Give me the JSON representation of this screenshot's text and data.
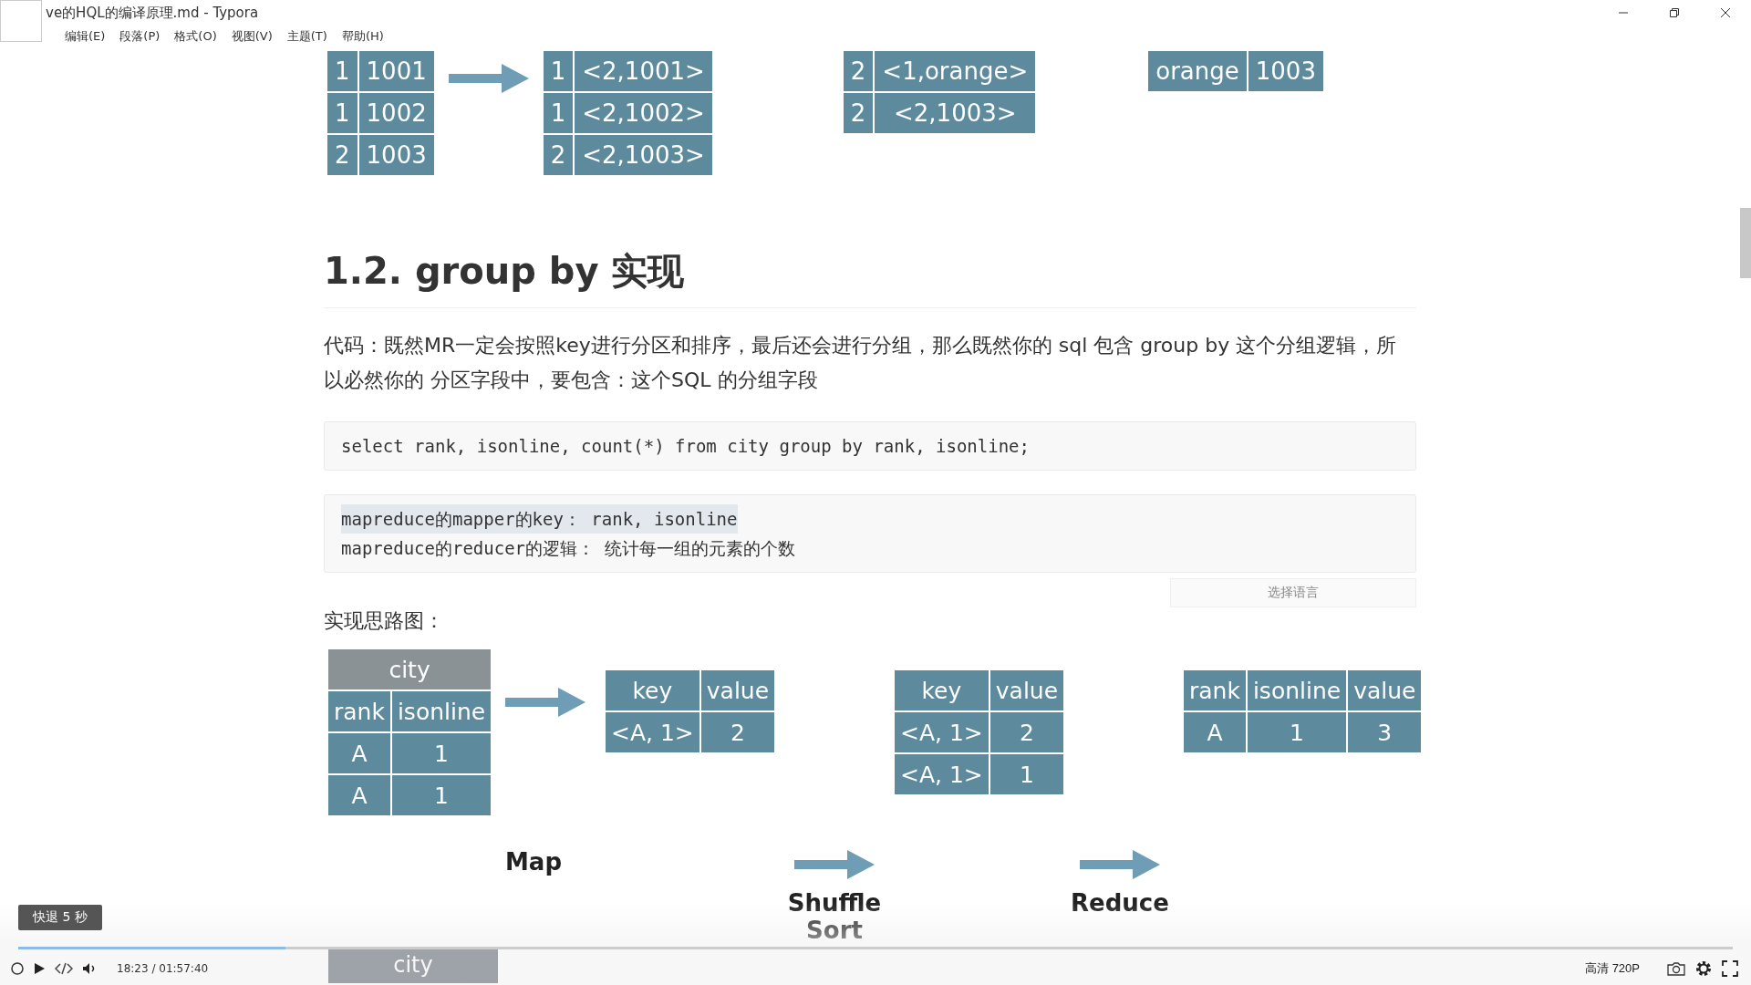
{
  "window": {
    "title": "ve的HQL的编译原理.md - Typora"
  },
  "menu": [
    {
      "label": "编辑(E)"
    },
    {
      "label": "段落(P)"
    },
    {
      "label": "格式(O)"
    },
    {
      "label": "视图(V)"
    },
    {
      "label": "主题(T)"
    },
    {
      "label": "帮助(H)"
    }
  ],
  "document": {
    "top_diagram": {
      "tables": [
        {
          "rows": [
            [
              "1",
              "1001"
            ],
            [
              "1",
              "1002"
            ],
            [
              "2",
              "1003"
            ]
          ]
        },
        {
          "rows": [
            [
              "1",
              "<2,1001>"
            ],
            [
              "1",
              "<2,1002>"
            ],
            [
              "2",
              "<2,1003>"
            ]
          ]
        },
        {
          "rows": [
            [
              "2",
              "<1,orange>"
            ],
            [
              "2",
              "<2,1003>"
            ]
          ]
        },
        {
          "rows": [
            [
              "orange",
              "1003"
            ]
          ]
        }
      ]
    },
    "heading": "1.2. group by 实现",
    "paragraph": "代码：既然MR一定会按照key进行分区和排序，最后还会进行分组，那么既然你的 sql 包含 group by 这个分组逻辑，所以必然你的 分区字段中，要包含：这个SQL 的分组字段",
    "code_blocks": [
      {
        "lines": [
          {
            "text": "select rank, isonline, count(*) from city group by rank, isonline;",
            "selected": false
          }
        ]
      },
      {
        "lines": [
          {
            "text": "mapreduce的mapper的key：  rank, isonline",
            "selected": true
          },
          {
            "text": "mapreduce的reducer的逻辑：  统计每一组的元素的个数",
            "selected": false
          }
        ],
        "language_button": "选择语言"
      }
    ],
    "figure_caption": "实现思路图：",
    "diagram": {
      "tables": [
        {
          "title": "city",
          "header": [
            "rank",
            "isonline"
          ],
          "rows": [
            [
              "A",
              "1"
            ],
            [
              "A",
              "1"
            ]
          ]
        },
        {
          "header": [
            "key",
            "value"
          ],
          "rows": [
            [
              "<A, 1>",
              "2"
            ]
          ]
        },
        {
          "header": [
            "key",
            "value"
          ],
          "rows": [
            [
              "<A, 1>",
              "2"
            ],
            [
              "<A, 1>",
              "1"
            ]
          ]
        },
        {
          "header": [
            "rank",
            "isonline",
            "value"
          ],
          "rows": [
            [
              "A",
              "1",
              "3"
            ]
          ]
        }
      ],
      "stages": [
        {
          "label": "Map",
          "arrow": false
        },
        {
          "label": "Shuffle Sort",
          "arrow": true
        },
        {
          "label": "Reduce",
          "arrow": true
        }
      ]
    },
    "next_table_title": "city"
  },
  "player": {
    "tooltip": "快退 5 秒",
    "level": 0.156,
    "time": "18:23 / 01:57:40",
    "quality": "高清 720P"
  }
}
